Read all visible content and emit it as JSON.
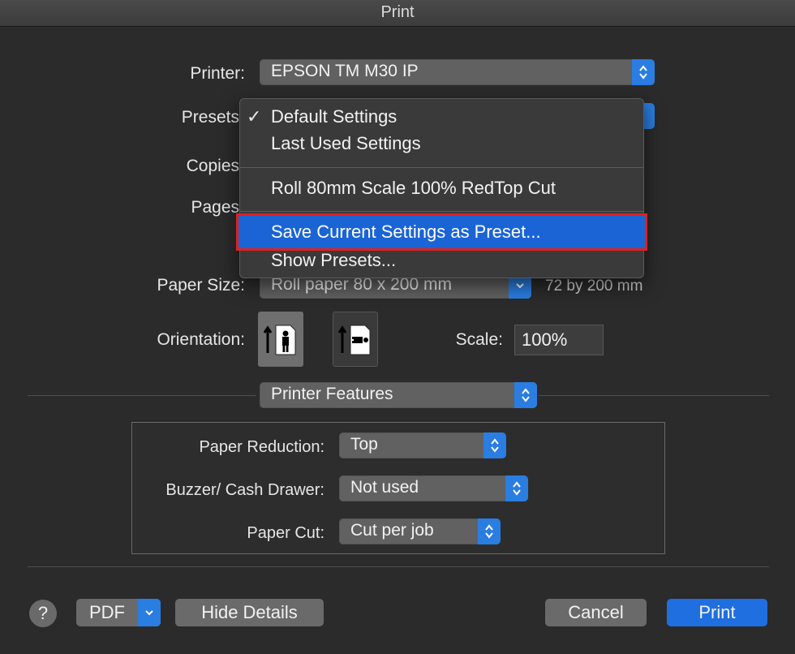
{
  "window": {
    "title": "Print"
  },
  "printer": {
    "label": "Printer:",
    "value": "EPSON TM M30 IP"
  },
  "presets": {
    "label": "Presets",
    "menu": {
      "checked_item": "Default Settings",
      "items": [
        "Default Settings",
        "Last Used Settings",
        "Roll 80mm Scale 100% RedTop Cut",
        "Save Current Settings as Preset...",
        "Show Presets..."
      ],
      "highlighted": "Save Current Settings as Preset..."
    }
  },
  "copies": {
    "label": "Copies"
  },
  "pages": {
    "label": "Pages"
  },
  "paper_size": {
    "label": "Paper Size:",
    "value": "Roll paper 80 x 200 mm",
    "dimensions": "72 by 200 mm"
  },
  "orientation": {
    "label": "Orientation:",
    "selected": "portrait"
  },
  "scale": {
    "label": "Scale:",
    "value": "100%"
  },
  "section": {
    "value": "Printer Features"
  },
  "features": {
    "paper_reduction": {
      "label": "Paper Reduction:",
      "value": "Top"
    },
    "buzzer": {
      "label": "Buzzer/ Cash Drawer:",
      "value": "Not used"
    },
    "paper_cut": {
      "label": "Paper Cut:",
      "value": "Cut per job"
    }
  },
  "footer": {
    "help": "?",
    "pdf": "PDF",
    "hide_details": "Hide Details",
    "cancel": "Cancel",
    "print": "Print"
  },
  "colors": {
    "accent": "#2a7de1",
    "highlight": "#1a64d6",
    "annotation": "#e0201e"
  }
}
